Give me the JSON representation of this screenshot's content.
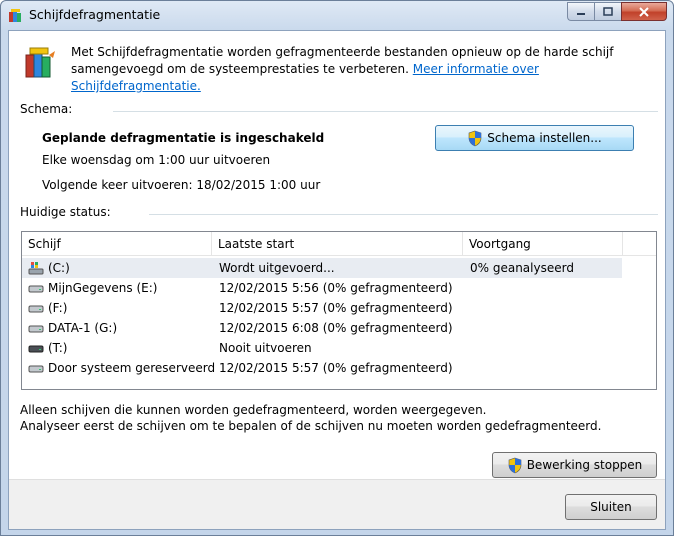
{
  "window": {
    "title": "Schijfdefragmentatie"
  },
  "intro": {
    "text": "Met Schijfdefragmentatie worden gefragmenteerde bestanden opnieuw op de harde schijf samengevoegd om de systeemprestaties te verbeteren.",
    "link": "Meer informatie over Schijfdefragmentatie."
  },
  "schedule": {
    "label": "Schema:",
    "status": "Geplande defragmentatie is ingeschakeld",
    "frequency": "Elke woensdag om 1:00 uur uitvoeren",
    "next_run": "Volgende keer uitvoeren: 18/02/2015 1:00 uur",
    "configure_button": "Schema instellen..."
  },
  "current_status": {
    "label": "Huidige status:",
    "columns": [
      "Schijf",
      "Laatste start",
      "Voortgang"
    ],
    "rows": [
      {
        "disk": "(C:)",
        "last_run": "Wordt uitgevoerd...",
        "progress": "0% geanalyseerd",
        "icon": "system-drive-icon"
      },
      {
        "disk": "MijnGegevens (E:)",
        "last_run": "12/02/2015 5:56 (0% gefragmenteerd)",
        "progress": "",
        "icon": "hard-drive-icon"
      },
      {
        "disk": "(F:)",
        "last_run": "12/02/2015 5:57 (0% gefragmenteerd)",
        "progress": "",
        "icon": "hard-drive-icon"
      },
      {
        "disk": "DATA-1 (G:)",
        "last_run": "12/02/2015 6:08 (0% gefragmenteerd)",
        "progress": "",
        "icon": "hard-drive-icon"
      },
      {
        "disk": "(T:)",
        "last_run": "Nooit uitvoeren",
        "progress": "",
        "icon": "removable-drive-icon"
      },
      {
        "disk": "Door systeem gereserveerd",
        "last_run": "12/02/2015 5:57 (0% gefragmenteerd)",
        "progress": "",
        "icon": "hard-drive-icon"
      }
    ]
  },
  "notes": {
    "line1": "Alleen schijven die kunnen worden gedefragmenteerd, worden weergegeven.",
    "line2": "Analyseer eerst de schijven om te bepalen of de schijven nu moeten worden gedefragmenteerd."
  },
  "actions": {
    "stop_button": "Bewerking stoppen",
    "close_button": "Sluiten"
  }
}
